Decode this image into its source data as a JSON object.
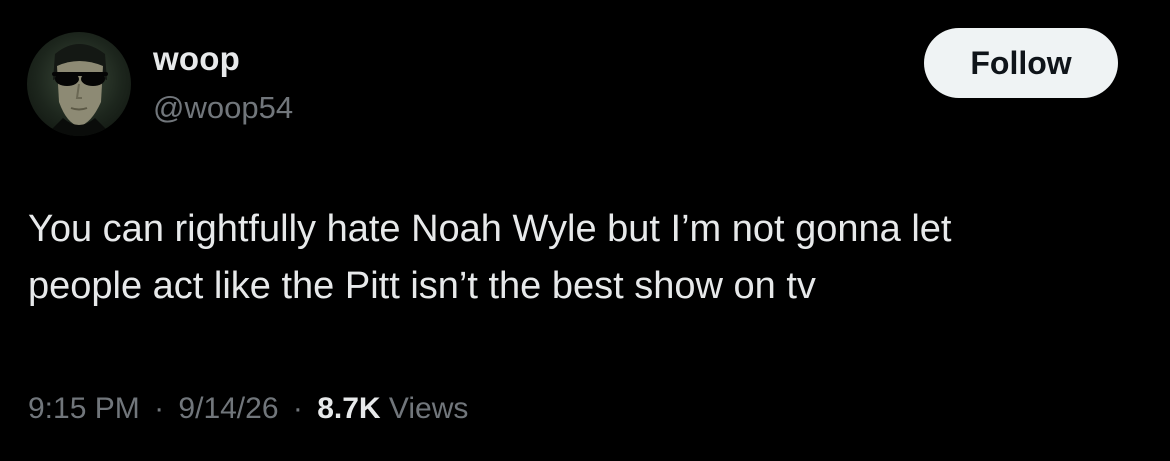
{
  "author": {
    "display_name": "woop",
    "handle": "@woop54"
  },
  "follow_button": {
    "label": "Follow"
  },
  "tweet": {
    "lines": [
      "You can rightfully hate Noah Wyle but I’m not gonna let",
      "people act like the Pitt isn’t the best show on tv"
    ]
  },
  "meta": {
    "time": "9:15 PM",
    "separator": "·",
    "date": "9/14/26",
    "views_count": "8.7K",
    "views_label": "Views"
  },
  "colors": {
    "background": "#000000",
    "primary_text": "#e7e9ea",
    "secondary_text": "#71767b",
    "follow_button_bg": "#eff3f4",
    "follow_button_text": "#0f1419"
  }
}
